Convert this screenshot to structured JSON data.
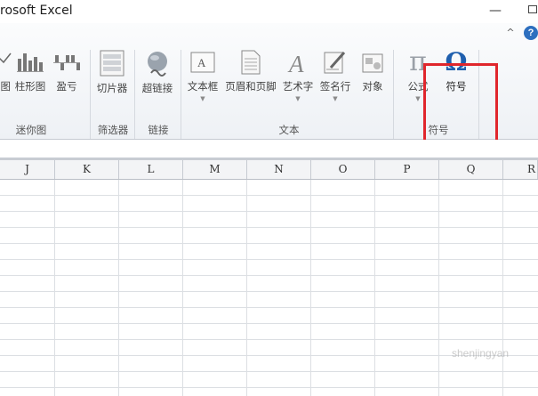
{
  "window": {
    "title": "rosoft Excel",
    "minimize_glyph": "—"
  },
  "ribbon": {
    "help_glyph": "?",
    "collapse_glyph": "^",
    "buttons": {
      "line_partial": "图",
      "column": "柱形图",
      "winloss": "盈亏",
      "slicer": "切片器",
      "hyperlink": "超链接",
      "textbox": "文本框",
      "header_footer": "页眉和页脚",
      "wordart": "艺术字",
      "signature": "签名行",
      "object": "对象",
      "equation": "公式",
      "symbol": "符号"
    },
    "groups": {
      "sparklines": "迷你图",
      "filter": "筛选器",
      "links": "链接",
      "text": "文本",
      "symbols": "符号"
    },
    "icons": {
      "equation": "π",
      "symbol": "Ω"
    },
    "accent": "#1f5fae",
    "highlight_color": "#e0262c"
  },
  "columns": [
    "J",
    "K",
    "L",
    "M",
    "N",
    "O",
    "P",
    "Q",
    "R"
  ],
  "watermark": "shenjingyan"
}
